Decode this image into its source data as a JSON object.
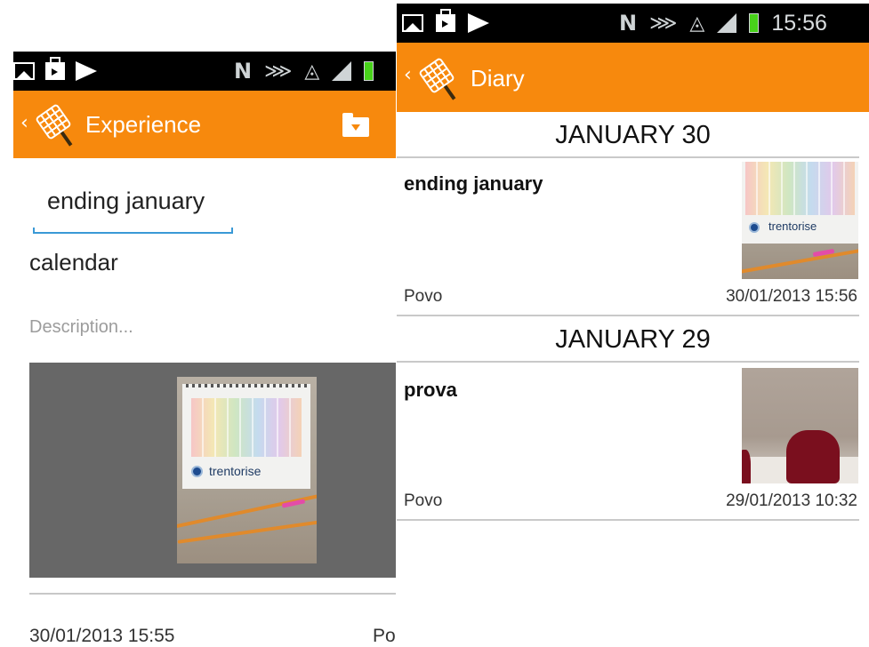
{
  "left_screen": {
    "action_bar": {
      "title": "Experience",
      "back_icon": "chevron-left-icon",
      "app_icon": "net-app-icon",
      "action_icon": "folder-download-icon"
    },
    "title_field": {
      "value": "ending january"
    },
    "tag_field": {
      "value": "calendar"
    },
    "description_field": {
      "placeholder": "Description..."
    },
    "photo": {
      "subject": "calendar on desk",
      "brand_text": "trentorise"
    },
    "footer": {
      "datetime": "30/01/2013 15:55",
      "location": "Po"
    }
  },
  "right_screen": {
    "status_bar": {
      "time": "15:56"
    },
    "action_bar": {
      "title": "Diary",
      "back_icon": "chevron-left-icon",
      "app_icon": "net-app-icon"
    },
    "sections": [
      {
        "header": "JANUARY 30",
        "entries": [
          {
            "title": "ending january",
            "location": "Povo",
            "datetime": "30/01/2013 15:56",
            "thumb_brand": "trentorise"
          }
        ]
      },
      {
        "header": "JANUARY 29",
        "entries": [
          {
            "title": "prova",
            "location": "Povo",
            "datetime": "29/01/2013 10:32"
          }
        ]
      }
    ]
  },
  "colors": {
    "action_bar": "#f7890d",
    "status_bar": "#000000",
    "accent_underline": "#3a99d6",
    "battery": "#48d21a"
  }
}
